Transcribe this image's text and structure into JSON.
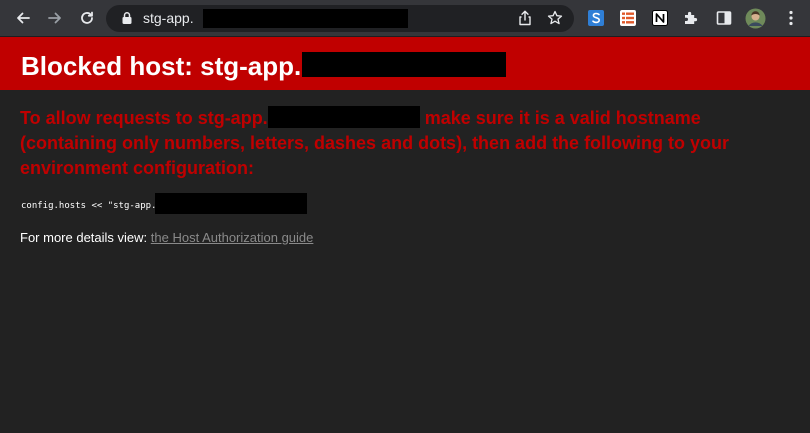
{
  "browser": {
    "back_icon": "arrow-left-icon",
    "forward_icon": "arrow-right-icon",
    "reload_icon": "reload-icon",
    "address_bar": {
      "url_prefix": "stg-app.",
      "lock_icon": "lock-icon"
    },
    "extensions": [
      {
        "name": "extension-s-icon",
        "color": "#2f7fd6"
      },
      {
        "name": "extension-list-icon",
        "color": "#e05a2b"
      },
      {
        "name": "notion-icon",
        "color": "#ffffff"
      },
      {
        "name": "puzzle-icon",
        "color": "#e8eaed"
      }
    ]
  },
  "page": {
    "header_color": "#c00000",
    "title_prefix": "Blocked host: stg-app.",
    "message_prefix": "To allow requests to stg-app.",
    "message_suffix": " make sure it is a valid hostname (containing only numbers, letters, dashes and dots), then add the following to your environment configuration:",
    "code_prefix": "config.hosts << \"stg-app.",
    "details_label": "For more details view: ",
    "details_link": "the Host Authorization guide"
  }
}
